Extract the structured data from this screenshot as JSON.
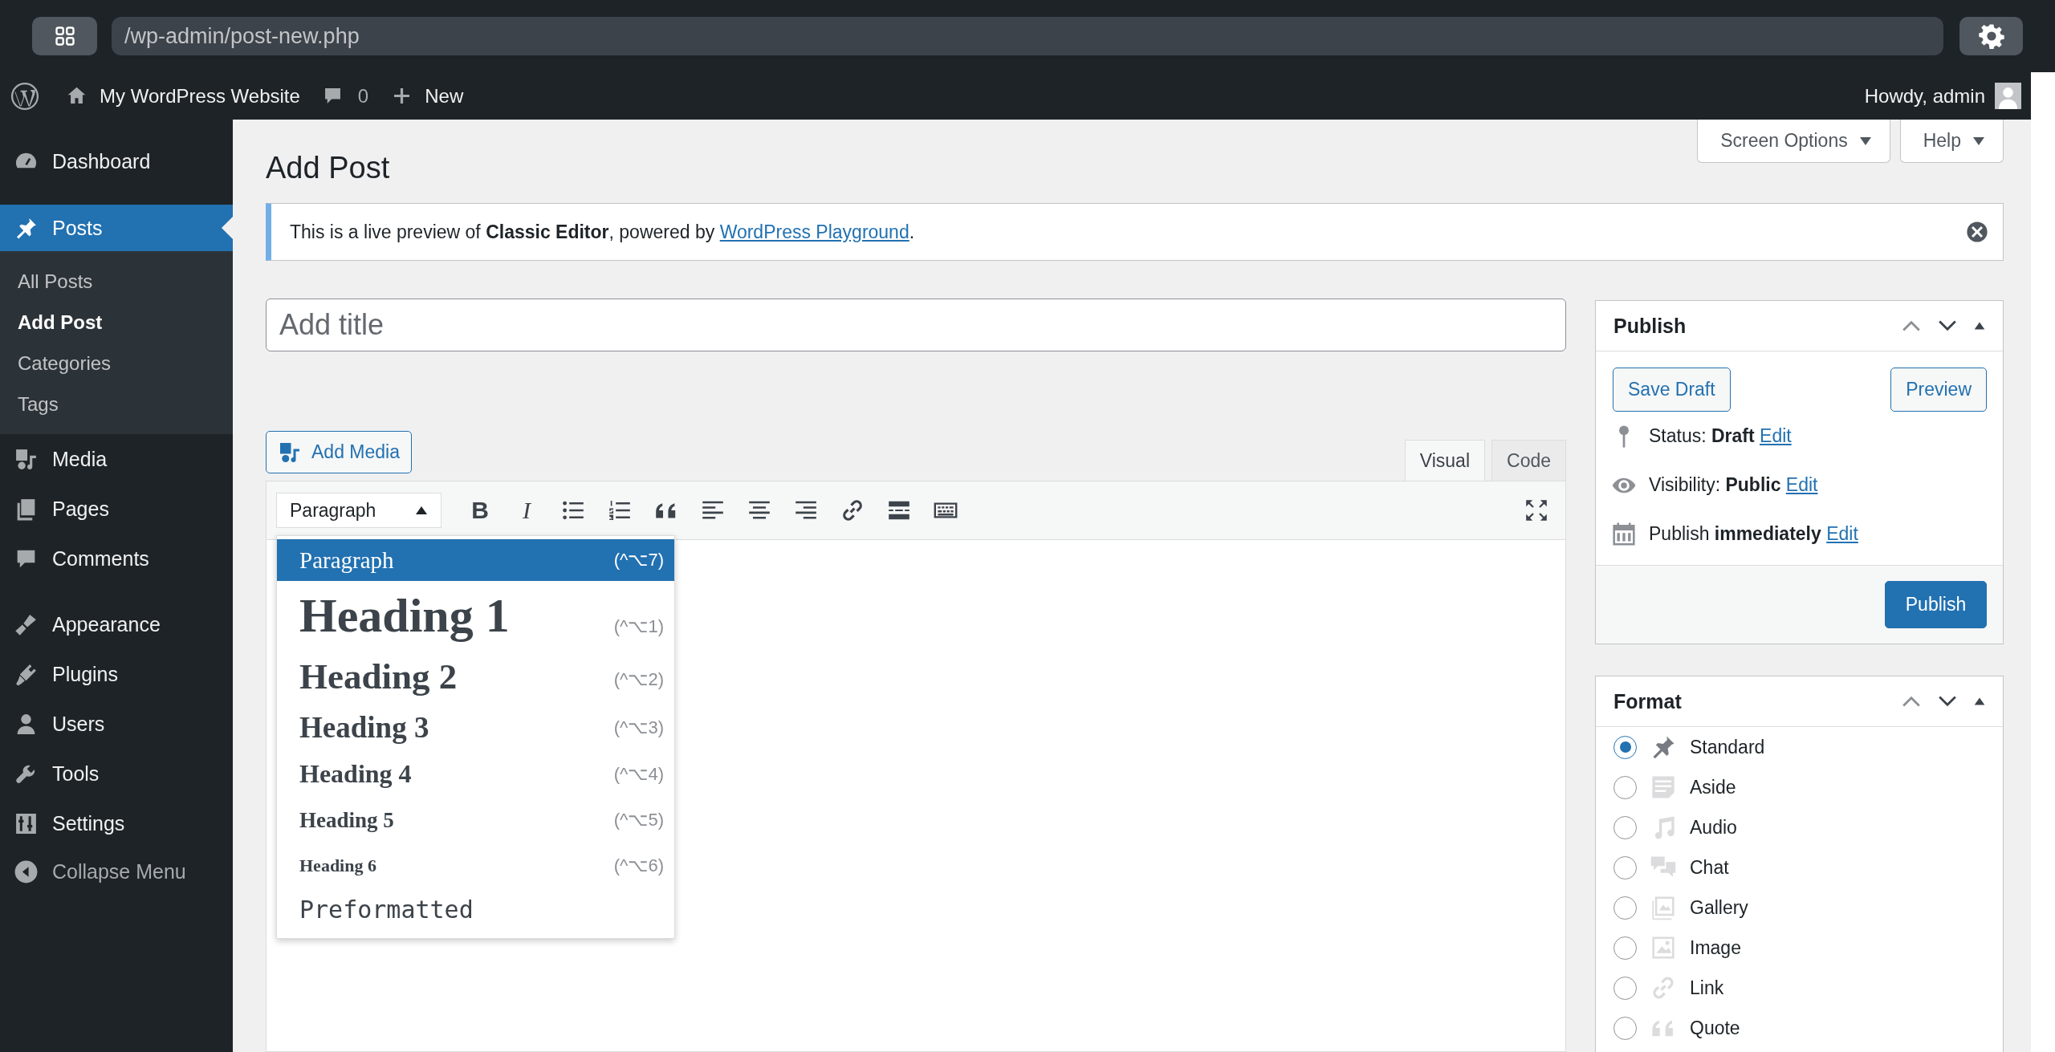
{
  "browser": {
    "address": "/wp-admin/post-new.php"
  },
  "admin_bar": {
    "site_name": "My WordPress Website",
    "comment_count": "0",
    "new_label": "New",
    "greeting": "Howdy, admin"
  },
  "sidebar": {
    "items": [
      {
        "label": "Dashboard",
        "kind": "dashboard",
        "selected": false
      },
      {
        "label": "Posts",
        "kind": "posts",
        "selected": true,
        "children": [
          {
            "label": "All Posts",
            "selected": false
          },
          {
            "label": "Add Post",
            "selected": true
          },
          {
            "label": "Categories",
            "selected": false
          },
          {
            "label": "Tags",
            "selected": false
          }
        ]
      },
      {
        "label": "Media",
        "kind": "media",
        "selected": false
      },
      {
        "label": "Pages",
        "kind": "pages",
        "selected": false
      },
      {
        "label": "Comments",
        "kind": "comments",
        "selected": false
      },
      {
        "label": "Appearance",
        "kind": "appearance",
        "selected": false
      },
      {
        "label": "Plugins",
        "kind": "plugins",
        "selected": false
      },
      {
        "label": "Users",
        "kind": "users",
        "selected": false
      },
      {
        "label": "Tools",
        "kind": "tools",
        "selected": false
      },
      {
        "label": "Settings",
        "kind": "settings",
        "selected": false
      }
    ],
    "collapse_label": "Collapse Menu"
  },
  "screen_tabs": [
    "Screen Options",
    "Help"
  ],
  "page_title": "Add Post",
  "notice": {
    "text": "This is a live preview of **Classic Editor**, powered by ",
    "link": "WordPress Playground",
    "after": "."
  },
  "title_field": {
    "placeholder": "Add title"
  },
  "add_media": "Add Media",
  "editor_tabs": [
    {
      "label": "Visual",
      "selected": true
    },
    {
      "label": "Code",
      "selected": false
    }
  ],
  "format_select": {
    "value": "Paragraph",
    "expanded": true
  },
  "format_menu": [
    {
      "label": "Paragraph",
      "shortcut": "(^⌥7)",
      "kind": "paragraph",
      "selected": true
    },
    {
      "label": "Heading 1",
      "shortcut": "(^⌥1)",
      "kind": "h1",
      "selected": false
    },
    {
      "label": "Heading 2",
      "shortcut": "(^⌥2)",
      "kind": "h2",
      "selected": false
    },
    {
      "label": "Heading 3",
      "shortcut": "(^⌥3)",
      "kind": "h3",
      "selected": false
    },
    {
      "label": "Heading 4",
      "shortcut": "(^⌥4)",
      "kind": "h4",
      "selected": false
    },
    {
      "label": "Heading 5",
      "shortcut": "(^⌥5)",
      "kind": "h5",
      "selected": false
    },
    {
      "label": "Heading 6",
      "shortcut": "(^⌥6)",
      "kind": "h6",
      "selected": false
    },
    {
      "label": "Preformatted",
      "kind": "pre",
      "selected": false
    }
  ],
  "toolbar": [
    {
      "kind": "bold",
      "glyph": "B"
    },
    {
      "kind": "italic",
      "glyph": "I"
    },
    {
      "kind": "bullets"
    },
    {
      "kind": "numbers"
    },
    {
      "kind": "quote"
    },
    {
      "kind": "align_left"
    },
    {
      "kind": "align_center"
    },
    {
      "kind": "align_right"
    },
    {
      "kind": "link"
    },
    {
      "kind": "more"
    },
    {
      "kind": "toolbar_toggle"
    }
  ],
  "publish_box": {
    "title": "Publish",
    "save_draft": "Save Draft",
    "preview": "Preview",
    "rows": [
      {
        "kind": "status",
        "label": "Status:",
        "value": "Draft",
        "link": "Edit"
      },
      {
        "kind": "visibility",
        "label": "Visibility:",
        "value": "Public",
        "link": "Edit"
      },
      {
        "kind": "schedule",
        "label": "Publish",
        "value": "immediately",
        "link": "Edit"
      }
    ],
    "publish_button": "Publish"
  },
  "format_box": {
    "title": "Format",
    "options": [
      {
        "label": "Standard",
        "kind": "standard",
        "selected": true
      },
      {
        "label": "Aside",
        "kind": "aside",
        "selected": false
      },
      {
        "label": "Audio",
        "kind": "audio",
        "selected": false
      },
      {
        "label": "Chat",
        "kind": "chat",
        "selected": false
      },
      {
        "label": "Gallery",
        "kind": "gallery",
        "selected": false
      },
      {
        "label": "Image",
        "kind": "image",
        "selected": false
      },
      {
        "label": "Link",
        "kind": "link",
        "selected": false
      },
      {
        "label": "Quote",
        "kind": "quote",
        "selected": false
      }
    ]
  }
}
